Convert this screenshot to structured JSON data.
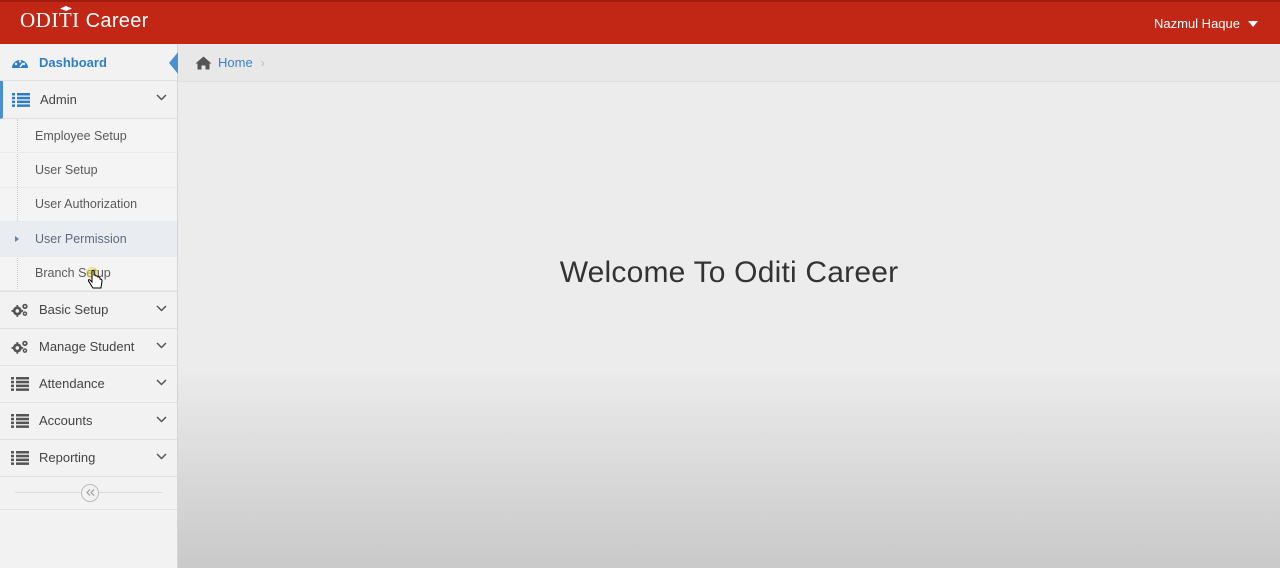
{
  "app": {
    "brand_part1": "ODITI",
    "brand_part2": "Career"
  },
  "header": {
    "user_name": "Nazmul Haque"
  },
  "sidebar": {
    "dashboard": "Dashboard",
    "admin": {
      "label": "Admin",
      "items": [
        {
          "label": "Employee Setup"
        },
        {
          "label": "User Setup"
        },
        {
          "label": "User Authorization"
        },
        {
          "label": "User Permission"
        },
        {
          "label": "Branch Setup"
        }
      ]
    },
    "basic_setup": "Basic Setup",
    "manage_student": "Manage Student",
    "attendance": "Attendance",
    "accounts": "Accounts",
    "reporting": "Reporting"
  },
  "breadcrumb": {
    "home": "Home"
  },
  "main": {
    "welcome": "Welcome To Oditi Career"
  },
  "colors": {
    "header": "#c22614",
    "accent": "#2e7ec7"
  }
}
